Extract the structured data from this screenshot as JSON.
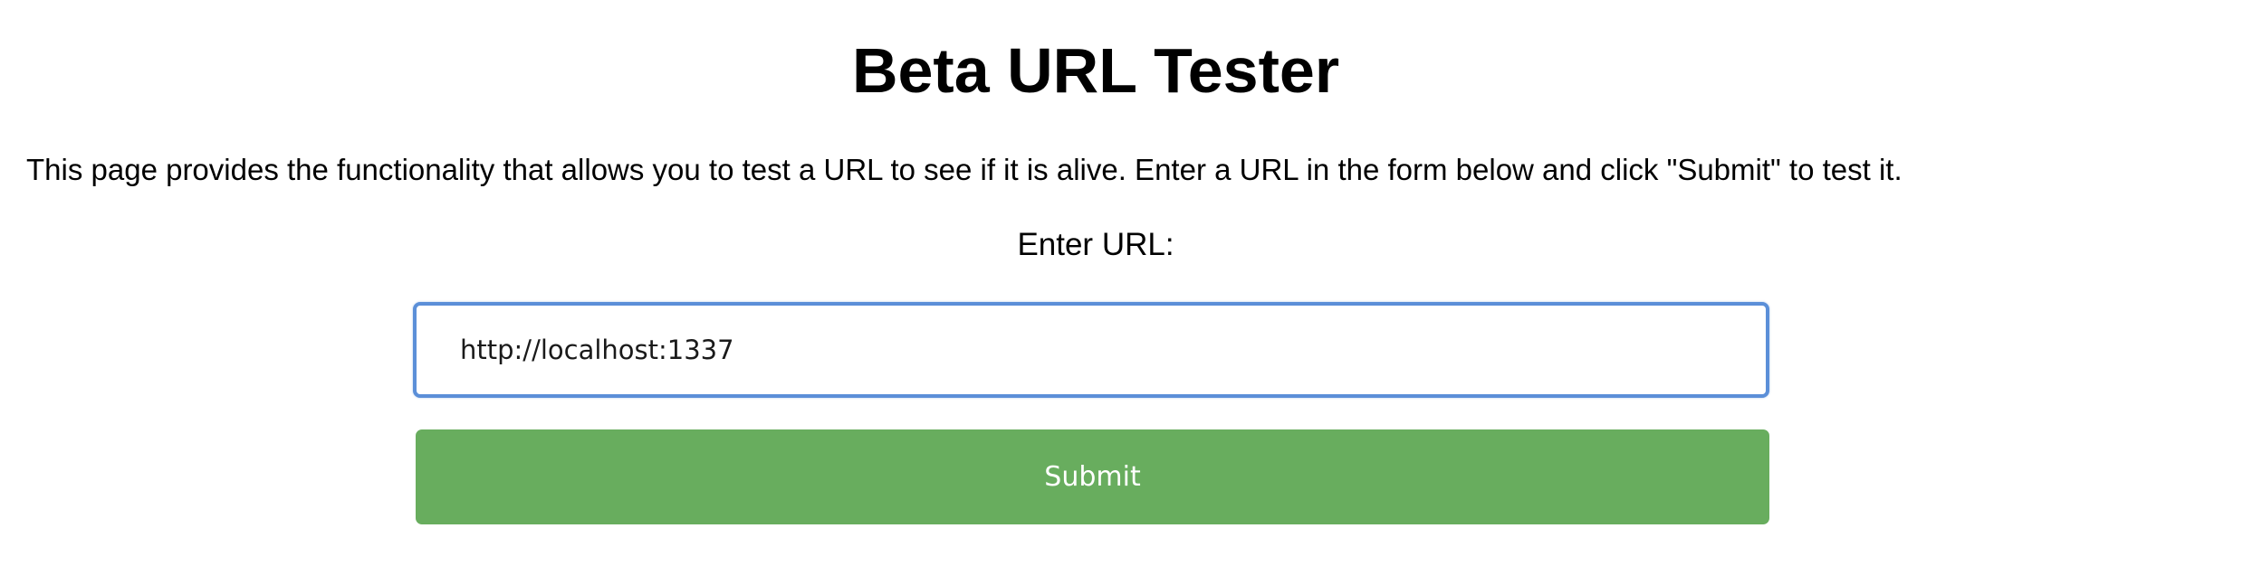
{
  "page": {
    "title": "Beta URL Tester",
    "description": "This page provides the functionality that allows you to test a URL to see if it is alive. Enter a URL in the form below and click \"Submit\" to test it."
  },
  "form": {
    "url_label": "Enter URL:",
    "url_value": "http://localhost:1337",
    "submit_label": "Submit"
  },
  "colors": {
    "submit_background": "#68ad5e",
    "input_focus_border": "#5b8fd8"
  }
}
